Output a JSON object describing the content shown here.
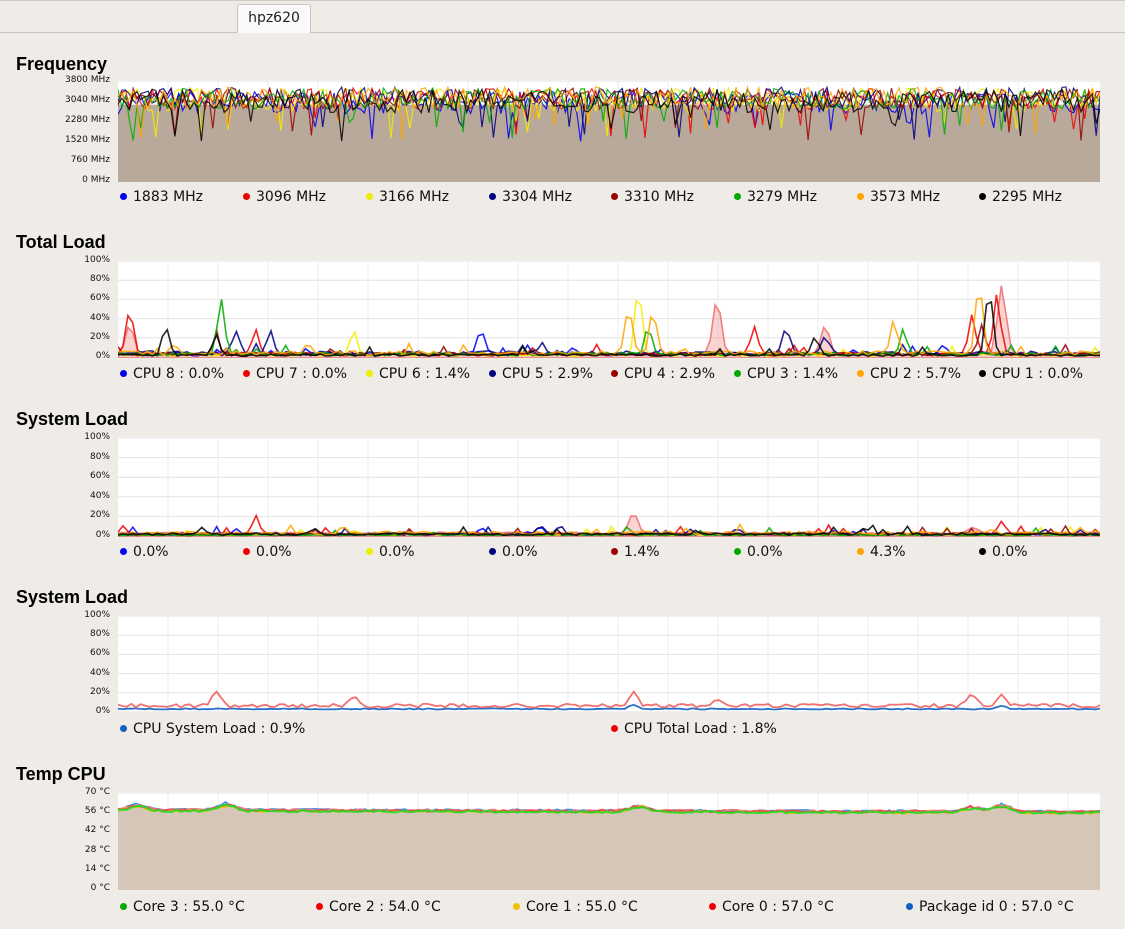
{
  "tabs": [
    {
      "label": "hpz620",
      "active": true
    }
  ],
  "colors": {
    "plot_bg": "#ffffff",
    "grid": "#e2e2e2",
    "area_fill": "#b9a99a",
    "temp_fill": "#d6c6b8"
  },
  "sections": [
    {
      "title": "Frequency",
      "yticks": [
        "3800 MHz",
        "3040 MHz",
        "2280 MHz",
        "1520 MHz",
        "760 MHz",
        "0 MHz"
      ],
      "legend": [
        {
          "label": "1883 MHz",
          "color": "#0000ee"
        },
        {
          "label": "3096 MHz",
          "color": "#ee0000"
        },
        {
          "label": "3166 MHz",
          "color": "#eeee00"
        },
        {
          "label": "3304 MHz",
          "color": "#00007f"
        },
        {
          "label": "3310 MHz",
          "color": "#9a0000"
        },
        {
          "label": "3279 MHz",
          "color": "#00aa00"
        },
        {
          "label": "3573 MHz",
          "color": "#ffa500"
        },
        {
          "label": "2295 MHz",
          "color": "#000000"
        }
      ]
    },
    {
      "title": "Total Load",
      "yticks": [
        "100%",
        "80%",
        "60%",
        "40%",
        "20%",
        "0%"
      ],
      "legend": [
        {
          "label": "CPU 8 : 0.0%",
          "color": "#0000ee"
        },
        {
          "label": "CPU 7 : 0.0%",
          "color": "#ee0000"
        },
        {
          "label": "CPU 6 : 1.4%",
          "color": "#eeee00"
        },
        {
          "label": "CPU 5 : 2.9%",
          "color": "#00007f"
        },
        {
          "label": "CPU 4 : 2.9%",
          "color": "#9a0000"
        },
        {
          "label": "CPU 3 : 1.4%",
          "color": "#00aa00"
        },
        {
          "label": "CPU 2 : 5.7%",
          "color": "#ffa500"
        },
        {
          "label": "CPU 1 : 0.0%",
          "color": "#000000"
        }
      ]
    },
    {
      "title": "System Load",
      "yticks": [
        "100%",
        "80%",
        "60%",
        "40%",
        "20%",
        "0%"
      ],
      "legend": [
        {
          "label": "0.0%",
          "color": "#0000ee"
        },
        {
          "label": "0.0%",
          "color": "#ee0000"
        },
        {
          "label": "0.0%",
          "color": "#eeee00"
        },
        {
          "label": "0.0%",
          "color": "#00007f"
        },
        {
          "label": "1.4%",
          "color": "#9a0000"
        },
        {
          "label": "0.0%",
          "color": "#00aa00"
        },
        {
          "label": "4.3%",
          "color": "#ffa500"
        },
        {
          "label": "0.0%",
          "color": "#000000"
        }
      ]
    },
    {
      "title": "System Load",
      "yticks": [
        "100%",
        "80%",
        "60%",
        "40%",
        "20%",
        "0%"
      ],
      "legend": [
        {
          "label": "CPU System Load : 0.9%",
          "color": "#1060c0"
        },
        {
          "label": "CPU Total Load : 1.8%",
          "color": "#ee0000"
        }
      ]
    },
    {
      "title": "Temp CPU",
      "yticks": [
        "70 °C",
        "56 °C",
        "42 °C",
        "28 °C",
        "14 °C",
        "0 °C"
      ],
      "legend": [
        {
          "label": "Core 3 : 55.0 °C",
          "color": "#00aa00"
        },
        {
          "label": "Core 2 : 54.0 °C",
          "color": "#ee0000"
        },
        {
          "label": "Core 1 : 55.0 °C",
          "color": "#f0c000"
        },
        {
          "label": "Core 0 : 57.0 °C",
          "color": "#ee0000"
        },
        {
          "label": "Package id 0 : 57.0 °C",
          "color": "#1060c0"
        }
      ]
    }
  ],
  "chart_data": [
    {
      "type": "line",
      "title": "Frequency",
      "ylim": [
        0,
        3800
      ],
      "yunit": "MHz",
      "series": [
        {
          "name": "1883 MHz",
          "color": "#0000ee",
          "baseline": 2900,
          "spread": 900
        },
        {
          "name": "3096 MHz",
          "color": "#ee0000",
          "baseline": 3050,
          "spread": 800
        },
        {
          "name": "3166 MHz",
          "color": "#eeee00",
          "baseline": 3000,
          "spread": 900
        },
        {
          "name": "3304 MHz",
          "color": "#00007f",
          "baseline": 3100,
          "spread": 800
        },
        {
          "name": "3310 MHz",
          "color": "#9a0000",
          "baseline": 3050,
          "spread": 800
        },
        {
          "name": "3279 MHz",
          "color": "#00aa00",
          "baseline": 3050,
          "spread": 800
        },
        {
          "name": "3573 MHz",
          "color": "#ffa500",
          "baseline": 3100,
          "spread": 800
        },
        {
          "name": "2295 MHz",
          "color": "#000000",
          "baseline": 2950,
          "spread": 900
        }
      ],
      "fill": 2900
    },
    {
      "type": "line",
      "title": "Total Load",
      "ylim": [
        0,
        100
      ],
      "series": [
        {
          "name": "CPU 8 : 0.0%",
          "color": "#0000ee",
          "base": 3,
          "spikes": [
            [
              0.37,
              22
            ],
            [
              0.84,
              8
            ]
          ]
        },
        {
          "name": "CPU 7 : 0.0%",
          "color": "#ee0000",
          "base": 3,
          "spikes": [
            [
              0.012,
              47
            ],
            [
              0.14,
              24
            ],
            [
              0.648,
              30
            ],
            [
              0.87,
              40
            ],
            [
              0.895,
              62
            ]
          ]
        },
        {
          "name": "CPU 6 : 1.4%",
          "color": "#eeee00",
          "base": 2,
          "spikes": [
            [
              0.53,
              70
            ],
            [
              0.24,
              25
            ]
          ]
        },
        {
          "name": "CPU 5 : 2.9%",
          "color": "#00007f",
          "base": 4,
          "spikes": [
            [
              0.12,
              22
            ],
            [
              0.155,
              22
            ],
            [
              0.43,
              8
            ],
            [
              0.68,
              27
            ],
            [
              0.72,
              20
            ]
          ]
        },
        {
          "name": "CPU 4 : 2.9%",
          "color": "#9a0000",
          "base": 3,
          "spikes": [
            [
              0.1,
              15
            ],
            [
              0.88,
              30
            ]
          ]
        },
        {
          "name": "CPU 3 : 1.4%",
          "color": "#00aa00",
          "base": 3,
          "spikes": [
            [
              0.105,
              57
            ],
            [
              0.54,
              30
            ],
            [
              0.8,
              25
            ]
          ]
        },
        {
          "name": "CPU 2 : 5.7%",
          "color": "#ffa500",
          "base": 4,
          "spikes": [
            [
              0.52,
              48
            ],
            [
              0.545,
              45
            ],
            [
              0.79,
              35
            ],
            [
              0.877,
              72
            ]
          ]
        },
        {
          "name": "CPU 1 : 0.0%",
          "color": "#000000",
          "base": 2,
          "spikes": [
            [
              0.049,
              29
            ],
            [
              0.1,
              20
            ],
            [
              0.71,
              20
            ],
            [
              0.887,
              70
            ]
          ]
        }
      ],
      "highlight": [
        {
          "color": "#f08080",
          "peaks": [
            [
              0.61,
              56
            ],
            [
              0.72,
              30
            ],
            [
              0.9,
              72
            ],
            [
              0.012,
              30
            ]
          ]
        }
      ]
    },
    {
      "type": "line",
      "title": "System Load",
      "ylim": [
        0,
        100
      ],
      "series": [
        {
          "name": "0.0%",
          "color": "#0000ee",
          "base": 1.5,
          "spikes": [
            [
              0.12,
              6
            ],
            [
              0.37,
              6
            ],
            [
              0.43,
              8
            ]
          ]
        },
        {
          "name": "0.0%",
          "color": "#ee0000",
          "base": 2,
          "spikes": [
            [
              0.005,
              8
            ],
            [
              0.14,
              19
            ],
            [
              0.9,
              14
            ]
          ]
        },
        {
          "name": "0.0%",
          "color": "#eeee00",
          "base": 1.5,
          "spikes": [
            [
              0.24,
              4
            ]
          ]
        },
        {
          "name": "0.0%",
          "color": "#00007f",
          "base": 2,
          "spikes": [
            [
              0.43,
              8
            ],
            [
              0.45,
              9
            ],
            [
              0.63,
              5
            ]
          ]
        },
        {
          "name": "1.4%",
          "color": "#9a0000",
          "base": 1.5,
          "spikes": [
            [
              0.2,
              4
            ]
          ]
        },
        {
          "name": "0.0%",
          "color": "#00aa00",
          "base": 1,
          "spikes": [
            [
              0.32,
              3
            ]
          ]
        },
        {
          "name": "4.3%",
          "color": "#ffa500",
          "base": 3,
          "spikes": [
            [
              0.98,
              7
            ],
            [
              0.23,
              6
            ]
          ]
        },
        {
          "name": "0.0%",
          "color": "#000000",
          "base": 2,
          "spikes": [
            [
              0.085,
              7
            ],
            [
              0.2,
              6
            ],
            [
              0.76,
              7
            ]
          ]
        }
      ],
      "highlight": [
        {
          "color": "#f08080",
          "peaks": [
            [
              0.525,
              20
            ],
            [
              0.87,
              6
            ]
          ]
        }
      ]
    },
    {
      "type": "line",
      "title": "System Load",
      "ylim": [
        0,
        100
      ],
      "series": [
        {
          "name": "CPU System Load : 0.9%",
          "color": "#1060c0",
          "base": 3,
          "spikes": [
            [
              0.525,
              8
            ],
            [
              0.9,
              6
            ]
          ]
        },
        {
          "name": "CPU Total Load : 1.8%",
          "color": "#ee0000",
          "base": 6,
          "spikes": [
            [
              0.1,
              19
            ],
            [
              0.24,
              13
            ],
            [
              0.525,
              19
            ],
            [
              0.61,
              10
            ],
            [
              0.87,
              17
            ],
            [
              0.9,
              17
            ]
          ]
        }
      ]
    },
    {
      "type": "area",
      "title": "Temp CPU",
      "ylim": [
        0,
        70
      ],
      "series": [
        {
          "name": "Core 3 : 55.0 °C",
          "color": "#22dd22",
          "base": 57
        },
        {
          "name": "Core 2 : 54.0 °C",
          "color": "#ee4444",
          "base": 57.5
        },
        {
          "name": "Core 1 : 55.0 °C",
          "color": "#f0c000",
          "base": 57
        },
        {
          "name": "Core 0 : 57.0 °C",
          "color": "#f07070",
          "base": 58
        },
        {
          "name": "Package id 0 : 57.0 °C",
          "color": "#3080e0",
          "base": 58
        }
      ],
      "bumps": [
        [
          0.02,
          62
        ],
        [
          0.11,
          63
        ],
        [
          0.53,
          63
        ],
        [
          0.87,
          62
        ],
        [
          0.9,
          64
        ]
      ]
    }
  ]
}
